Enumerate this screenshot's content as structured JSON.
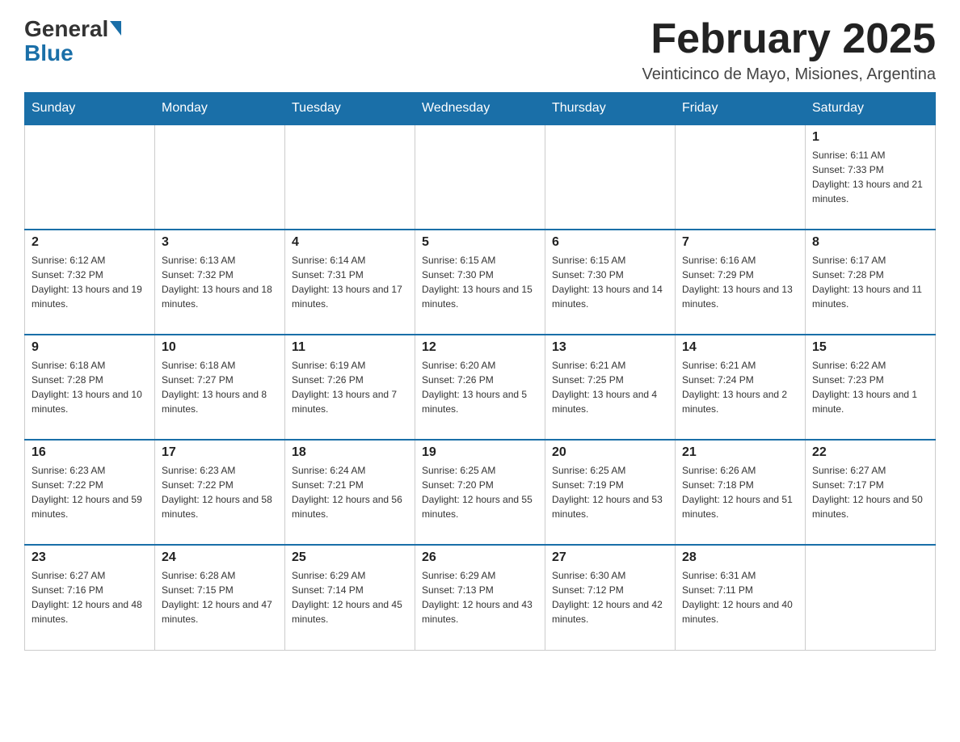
{
  "header": {
    "logo_general": "General",
    "logo_blue": "Blue",
    "month_title": "February 2025",
    "subtitle": "Veinticinco de Mayo, Misiones, Argentina"
  },
  "weekdays": [
    "Sunday",
    "Monday",
    "Tuesday",
    "Wednesday",
    "Thursday",
    "Friday",
    "Saturday"
  ],
  "weeks": [
    {
      "days": [
        {
          "date": "",
          "info": ""
        },
        {
          "date": "",
          "info": ""
        },
        {
          "date": "",
          "info": ""
        },
        {
          "date": "",
          "info": ""
        },
        {
          "date": "",
          "info": ""
        },
        {
          "date": "",
          "info": ""
        },
        {
          "date": "1",
          "info": "Sunrise: 6:11 AM\nSunset: 7:33 PM\nDaylight: 13 hours and 21 minutes."
        }
      ]
    },
    {
      "days": [
        {
          "date": "2",
          "info": "Sunrise: 6:12 AM\nSunset: 7:32 PM\nDaylight: 13 hours and 19 minutes."
        },
        {
          "date": "3",
          "info": "Sunrise: 6:13 AM\nSunset: 7:32 PM\nDaylight: 13 hours and 18 minutes."
        },
        {
          "date": "4",
          "info": "Sunrise: 6:14 AM\nSunset: 7:31 PM\nDaylight: 13 hours and 17 minutes."
        },
        {
          "date": "5",
          "info": "Sunrise: 6:15 AM\nSunset: 7:30 PM\nDaylight: 13 hours and 15 minutes."
        },
        {
          "date": "6",
          "info": "Sunrise: 6:15 AM\nSunset: 7:30 PM\nDaylight: 13 hours and 14 minutes."
        },
        {
          "date": "7",
          "info": "Sunrise: 6:16 AM\nSunset: 7:29 PM\nDaylight: 13 hours and 13 minutes."
        },
        {
          "date": "8",
          "info": "Sunrise: 6:17 AM\nSunset: 7:28 PM\nDaylight: 13 hours and 11 minutes."
        }
      ]
    },
    {
      "days": [
        {
          "date": "9",
          "info": "Sunrise: 6:18 AM\nSunset: 7:28 PM\nDaylight: 13 hours and 10 minutes."
        },
        {
          "date": "10",
          "info": "Sunrise: 6:18 AM\nSunset: 7:27 PM\nDaylight: 13 hours and 8 minutes."
        },
        {
          "date": "11",
          "info": "Sunrise: 6:19 AM\nSunset: 7:26 PM\nDaylight: 13 hours and 7 minutes."
        },
        {
          "date": "12",
          "info": "Sunrise: 6:20 AM\nSunset: 7:26 PM\nDaylight: 13 hours and 5 minutes."
        },
        {
          "date": "13",
          "info": "Sunrise: 6:21 AM\nSunset: 7:25 PM\nDaylight: 13 hours and 4 minutes."
        },
        {
          "date": "14",
          "info": "Sunrise: 6:21 AM\nSunset: 7:24 PM\nDaylight: 13 hours and 2 minutes."
        },
        {
          "date": "15",
          "info": "Sunrise: 6:22 AM\nSunset: 7:23 PM\nDaylight: 13 hours and 1 minute."
        }
      ]
    },
    {
      "days": [
        {
          "date": "16",
          "info": "Sunrise: 6:23 AM\nSunset: 7:22 PM\nDaylight: 12 hours and 59 minutes."
        },
        {
          "date": "17",
          "info": "Sunrise: 6:23 AM\nSunset: 7:22 PM\nDaylight: 12 hours and 58 minutes."
        },
        {
          "date": "18",
          "info": "Sunrise: 6:24 AM\nSunset: 7:21 PM\nDaylight: 12 hours and 56 minutes."
        },
        {
          "date": "19",
          "info": "Sunrise: 6:25 AM\nSunset: 7:20 PM\nDaylight: 12 hours and 55 minutes."
        },
        {
          "date": "20",
          "info": "Sunrise: 6:25 AM\nSunset: 7:19 PM\nDaylight: 12 hours and 53 minutes."
        },
        {
          "date": "21",
          "info": "Sunrise: 6:26 AM\nSunset: 7:18 PM\nDaylight: 12 hours and 51 minutes."
        },
        {
          "date": "22",
          "info": "Sunrise: 6:27 AM\nSunset: 7:17 PM\nDaylight: 12 hours and 50 minutes."
        }
      ]
    },
    {
      "days": [
        {
          "date": "23",
          "info": "Sunrise: 6:27 AM\nSunset: 7:16 PM\nDaylight: 12 hours and 48 minutes."
        },
        {
          "date": "24",
          "info": "Sunrise: 6:28 AM\nSunset: 7:15 PM\nDaylight: 12 hours and 47 minutes."
        },
        {
          "date": "25",
          "info": "Sunrise: 6:29 AM\nSunset: 7:14 PM\nDaylight: 12 hours and 45 minutes."
        },
        {
          "date": "26",
          "info": "Sunrise: 6:29 AM\nSunset: 7:13 PM\nDaylight: 12 hours and 43 minutes."
        },
        {
          "date": "27",
          "info": "Sunrise: 6:30 AM\nSunset: 7:12 PM\nDaylight: 12 hours and 42 minutes."
        },
        {
          "date": "28",
          "info": "Sunrise: 6:31 AM\nSunset: 7:11 PM\nDaylight: 12 hours and 40 minutes."
        },
        {
          "date": "",
          "info": ""
        }
      ]
    }
  ]
}
